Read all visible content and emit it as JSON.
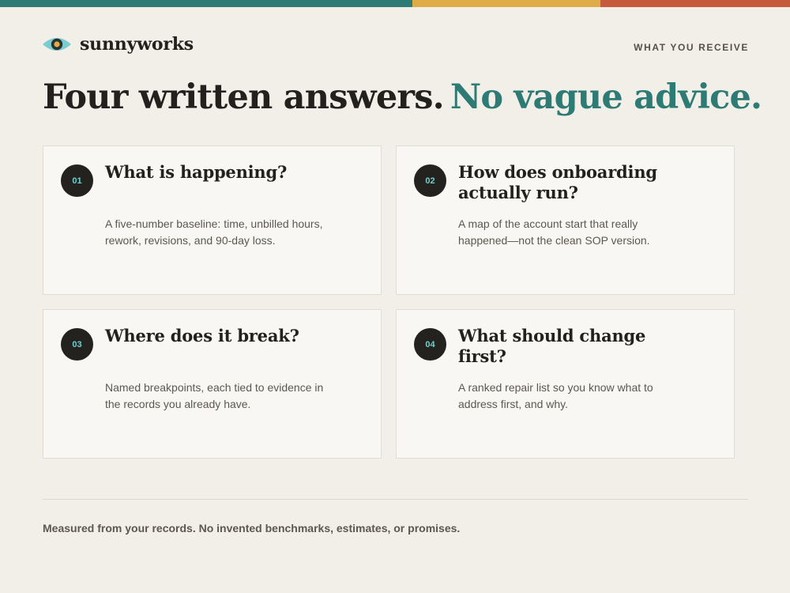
{
  "brand": {
    "name": "sunnyworks",
    "logo_icon": "eye-icon",
    "colors": {
      "teal": "#2e7a74",
      "gold": "#e0ac48",
      "red": "#c65b3b",
      "light_teal": "#79cdd0"
    }
  },
  "header": {
    "eyebrow": "WHAT YOU RECEIVE"
  },
  "headline": {
    "main": "Four written answers.",
    "accent": "No vague advice."
  },
  "cards": [
    {
      "number": "01",
      "title": "What is happening?",
      "body": "A five-number baseline: time, unbilled hours, rework, revisions, and 90-day loss."
    },
    {
      "number": "02",
      "title": "How does onboarding actually run?",
      "body": "A map of the account start that really happened—not the clean SOP version."
    },
    {
      "number": "03",
      "title": "Where does it break?",
      "body": "Named breakpoints, each tied to evidence in the records you already have."
    },
    {
      "number": "04",
      "title": "What should change first?",
      "body": "A ranked repair list so you know what to address first, and why."
    }
  ],
  "footer": {
    "note": "Measured from your records. No invented benchmarks, estimates, or promises."
  }
}
